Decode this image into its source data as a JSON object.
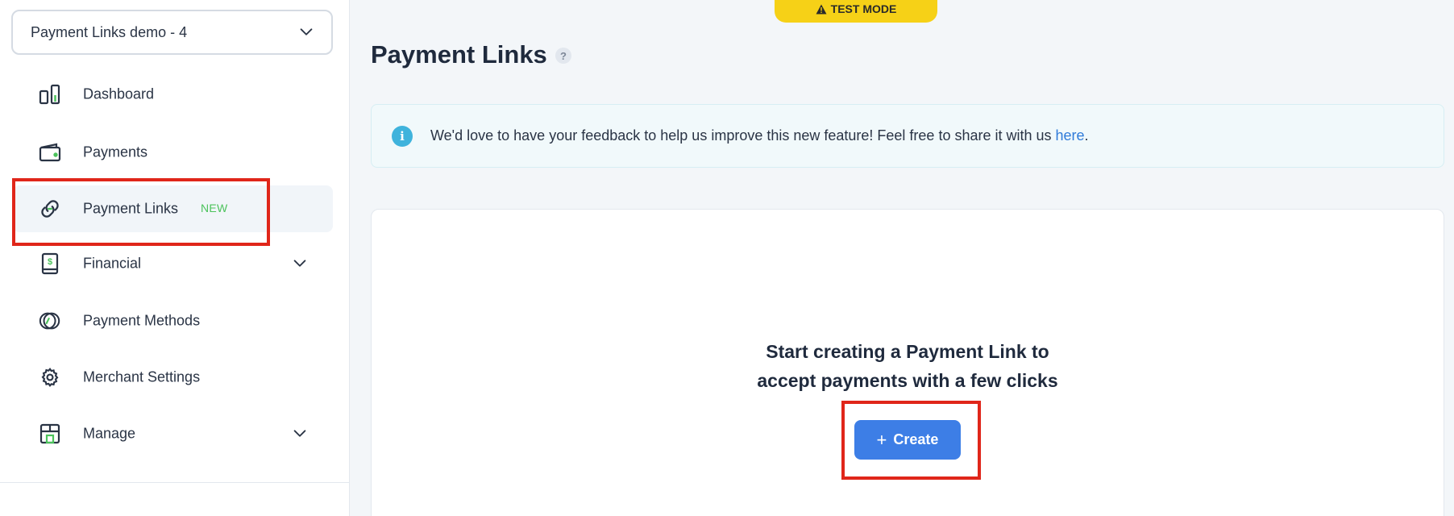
{
  "merchant_select": {
    "value": "Payment Links demo - 4"
  },
  "sidebar": {
    "items": [
      {
        "label": "Dashboard",
        "icon": "dashboard-icon"
      },
      {
        "label": "Payments",
        "icon": "wallet-icon"
      },
      {
        "label": "Payment Links",
        "icon": "link-icon",
        "badge": "NEW",
        "active": true
      },
      {
        "label": "Financial",
        "icon": "financial-icon",
        "expandable": true
      },
      {
        "label": "Payment Methods",
        "icon": "payment-methods-icon"
      },
      {
        "label": "Merchant Settings",
        "icon": "gear-icon"
      },
      {
        "label": "Manage",
        "icon": "store-icon",
        "expandable": true
      }
    ]
  },
  "header": {
    "test_mode": "TEST MODE",
    "title": "Payment Links",
    "help": "?"
  },
  "banner": {
    "text": "We'd love to have your feedback to help us improve this new feature! Feel free to share it with us ",
    "link": "here",
    "suffix": "."
  },
  "empty_state": {
    "line1": "Start creating a Payment Link to",
    "line2": "accept payments with a few clicks",
    "create_label": "Create"
  },
  "colors": {
    "accent": "#3d7ee6",
    "test_mode": "#f6d117",
    "highlight": "#e0261a",
    "new_badge": "#4cc35c",
    "info": "#3fb3dc"
  }
}
